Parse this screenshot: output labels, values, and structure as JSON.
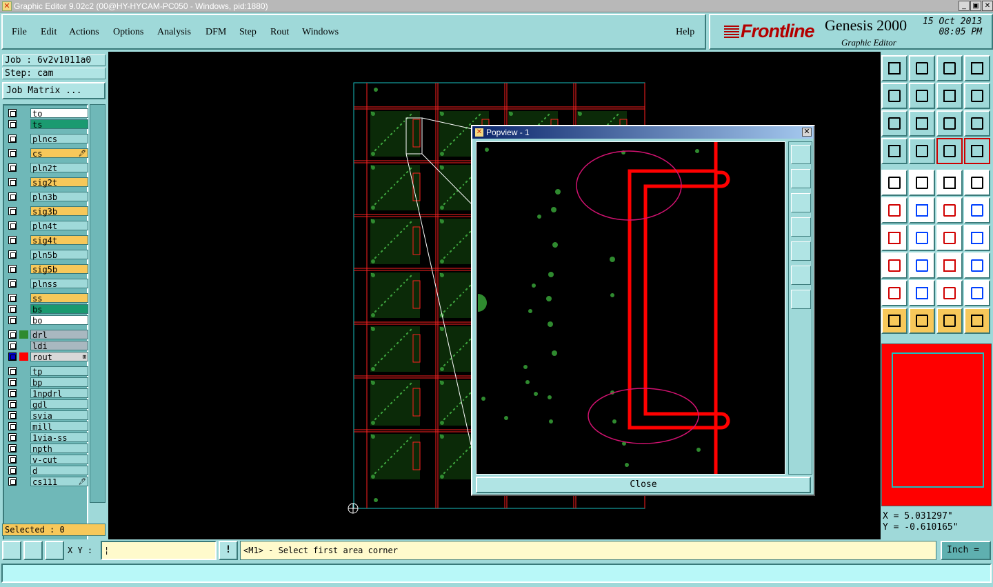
{
  "window": {
    "title": "Graphic Editor 9.02c2 (00@HY-HYCAM-PC050 - Windows, pid:1880)",
    "controls": [
      "_",
      "▣",
      "✕"
    ]
  },
  "menu": {
    "items": [
      "File",
      "Edit",
      "Actions",
      "Options",
      "Analysis",
      "DFM",
      "Step",
      "Rout",
      "Windows"
    ],
    "help": "Help"
  },
  "brand": {
    "logo": "Frontline",
    "product": "Genesis 2000",
    "subtitle": "Graphic Editor",
    "date": "15 Oct 2013",
    "time": "08:05 PM"
  },
  "job": {
    "job_line": "Job : 6v2v1011a0",
    "step_line": "Step: cam",
    "matrix_button": "Job Matrix ...",
    "selected": "Selected : 0"
  },
  "layers": [
    {
      "name": "to",
      "color": "#ffffff",
      "text": "#000"
    },
    {
      "name": "ts",
      "color": "#1a9a70",
      "text": "#000"
    },
    {
      "name": "plncs",
      "color": "#9fd9d9",
      "text": "#000"
    },
    {
      "name": "cs",
      "color": "#f7c85a",
      "text": "#000",
      "flag": "🖊"
    },
    {
      "name": "pln2t",
      "color": "#9fd9d9",
      "text": "#000"
    },
    {
      "name": "sig2t",
      "color": "#f7c85a",
      "text": "#000"
    },
    {
      "name": "pln3b",
      "color": "#9fd9d9",
      "text": "#000"
    },
    {
      "name": "sig3b",
      "color": "#f7c85a",
      "text": "#000"
    },
    {
      "name": "pln4t",
      "color": "#9fd9d9",
      "text": "#000"
    },
    {
      "name": "sig4t",
      "color": "#f7c85a",
      "text": "#000"
    },
    {
      "name": "pln5b",
      "color": "#9fd9d9",
      "text": "#000"
    },
    {
      "name": "sig5b",
      "color": "#f7c85a",
      "text": "#000"
    },
    {
      "name": "plnss",
      "color": "#9fd9d9",
      "text": "#000"
    },
    {
      "name": "ss",
      "color": "#f7c85a",
      "text": "#000"
    },
    {
      "name": "bs",
      "color": "#1a9a70",
      "text": "#000"
    },
    {
      "name": "bo",
      "color": "#ffffff",
      "text": "#000"
    },
    {
      "name": "drl",
      "color": "#a9b8c0",
      "text": "#000",
      "swatch": "#2f8a2f"
    },
    {
      "name": "ldi",
      "color": "#a9b8c0",
      "text": "#000"
    },
    {
      "name": "rout",
      "color": "#d8d8d8",
      "text": "#000",
      "swatch": "#ff0000",
      "check": "#0000cc",
      "flag": "⊞"
    },
    {
      "name": "tp",
      "color": "#9fd9d9",
      "text": "#000"
    },
    {
      "name": "bp",
      "color": "#9fd9d9",
      "text": "#000"
    },
    {
      "name": "1npdrl",
      "color": "#9fd9d9",
      "text": "#000"
    },
    {
      "name": "gdl",
      "color": "#9fd9d9",
      "text": "#000"
    },
    {
      "name": "svia",
      "color": "#9fd9d9",
      "text": "#000"
    },
    {
      "name": "mill",
      "color": "#9fd9d9",
      "text": "#000"
    },
    {
      "name": "1via-ss",
      "color": "#9fd9d9",
      "text": "#000"
    },
    {
      "name": "npth",
      "color": "#9fd9d9",
      "text": "#000"
    },
    {
      "name": "v-cut",
      "color": "#9fd9d9",
      "text": "#000"
    },
    {
      "name": "d",
      "color": "#9fd9d9",
      "text": "#000"
    },
    {
      "name": "cs111",
      "color": "#9fd9d9",
      "text": "#000",
      "flag": "🖊"
    }
  ],
  "popview": {
    "title": "Popview - 1",
    "close_label": "Close"
  },
  "coords": {
    "x": "X =  5.031297\"",
    "y": "Y = -0.610165\""
  },
  "bottom": {
    "xy_label": "X Y :",
    "status": "<M1> - Select first area corner",
    "unit": "Inch ="
  }
}
